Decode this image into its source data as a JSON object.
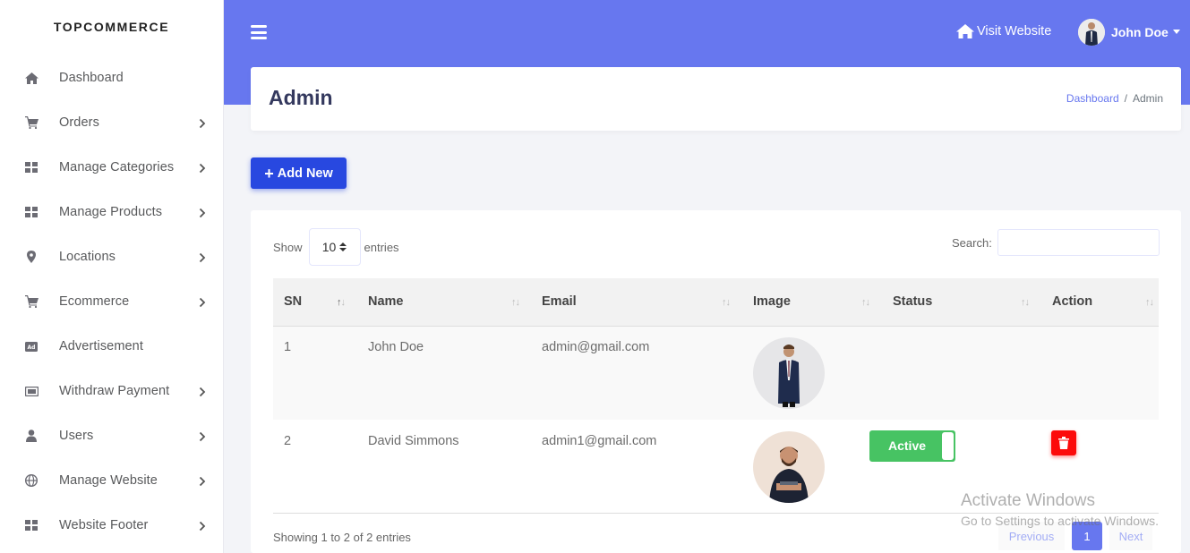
{
  "sidebar": {
    "brand": "TOPCOMMERCE",
    "items": [
      {
        "label": "Dashboard",
        "icon": "home-icon",
        "has_children": false
      },
      {
        "label": "Orders",
        "icon": "cart-icon",
        "has_children": true
      },
      {
        "label": "Manage Categories",
        "icon": "grid-icon",
        "has_children": true
      },
      {
        "label": "Manage Products",
        "icon": "grid-icon",
        "has_children": true
      },
      {
        "label": "Locations",
        "icon": "map-pin-icon",
        "has_children": true
      },
      {
        "label": "Ecommerce",
        "icon": "cart-icon",
        "has_children": true
      },
      {
        "label": "Advertisement",
        "icon": "ad-icon",
        "has_children": false
      },
      {
        "label": "Withdraw Payment",
        "icon": "money-icon",
        "has_children": true
      },
      {
        "label": "Users",
        "icon": "user-icon",
        "has_children": true
      },
      {
        "label": "Manage Website",
        "icon": "globe-icon",
        "has_children": true
      },
      {
        "label": "Website Footer",
        "icon": "grid-icon",
        "has_children": true
      }
    ]
  },
  "header": {
    "visit_label": "Visit Website",
    "user_name": "John Doe",
    "accent": "#6777ef"
  },
  "page": {
    "title": "Admin",
    "breadcrumb": {
      "home": "Dashboard",
      "current": "Admin"
    },
    "add_label": "Add New"
  },
  "table": {
    "show_label": "Show",
    "page_length": "10",
    "entries_label": "entries",
    "search_label": "Search:",
    "columns": [
      "SN",
      "Name",
      "Email",
      "Image",
      "Status",
      "Action"
    ],
    "rows": [
      {
        "sn": "1",
        "name": "John Doe",
        "email": "admin@gmail.com",
        "image": "john-doe-photo",
        "status": "",
        "action": ""
      },
      {
        "sn": "2",
        "name": "David Simmons",
        "email": "admin1@gmail.com",
        "image": "david-simmons-photo",
        "status": "Active",
        "action": "delete"
      }
    ],
    "info": "Showing 1 to 2 of 2 entries",
    "pagination": {
      "previous": "Previous",
      "current": "1",
      "next": "Next"
    },
    "status_color": "#47c363",
    "delete_color": "#fc0b0b"
  },
  "watermark": {
    "line1": "Activate Windows",
    "line2": "Go to Settings to activate Windows."
  }
}
